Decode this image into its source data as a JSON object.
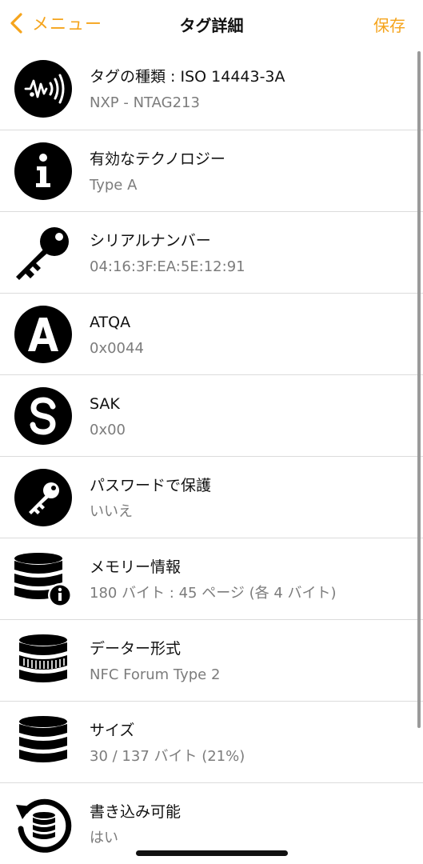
{
  "nav": {
    "back_label": "メニュー",
    "title": "タグ詳細",
    "save_label": "保存"
  },
  "colors": {
    "accent": "#f5a41c",
    "subtitle": "#7c7c7c",
    "separator": "#dcdcdc"
  },
  "rows": [
    {
      "icon": "nfc-tag-icon",
      "title": "タグの種類 : ISO 14443-3A",
      "subtitle": "NXP - NTAG213"
    },
    {
      "icon": "info-icon",
      "title": "有効なテクノロジー",
      "subtitle": "Type A"
    },
    {
      "icon": "key-icon",
      "title": "シリアルナンバー",
      "subtitle": "04:16:3F:EA:5E:12:91"
    },
    {
      "icon": "letter-a-icon",
      "title": "ATQA",
      "subtitle": "0x0044"
    },
    {
      "icon": "letter-s-icon",
      "title": "SAK",
      "subtitle": "0x00"
    },
    {
      "icon": "password-key-icon",
      "title": "パスワードで保護",
      "subtitle": "いいえ"
    },
    {
      "icon": "database-info-icon",
      "title": "メモリー情報",
      "subtitle": "180 バイト : 45 ページ (各 4 バイト)"
    },
    {
      "icon": "database-format-icon",
      "title": "データー形式",
      "subtitle": "NFC Forum Type 2"
    },
    {
      "icon": "database-size-icon",
      "title": "サイズ",
      "subtitle": "30 / 137 バイト (21%)"
    },
    {
      "icon": "database-rewrite-icon",
      "title": "書き込み可能",
      "subtitle": "はい"
    }
  ]
}
